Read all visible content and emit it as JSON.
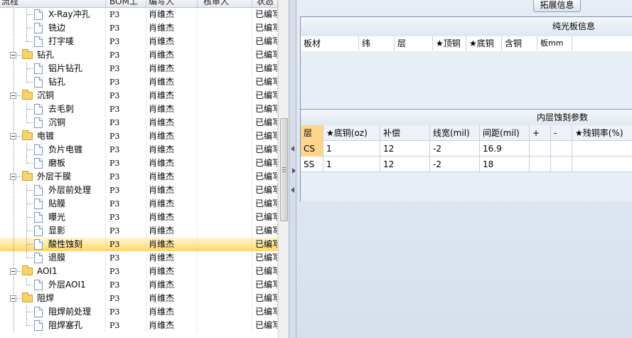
{
  "tree_grid": {
    "columns": {
      "process": "流程",
      "bom": "BOM工",
      "author": "编写人",
      "reviewer": "核审人",
      "status": "状态"
    },
    "rows": [
      {
        "type": "child",
        "label": "X-Ray冲孔",
        "bom": "P3",
        "author": "肖维杰",
        "reviewer": "",
        "status": "已编写",
        "selected": false
      },
      {
        "type": "child",
        "label": "铣边",
        "bom": "P3",
        "author": "肖维杰",
        "reviewer": "",
        "status": "已编写",
        "selected": false
      },
      {
        "type": "child",
        "label": "打字唛",
        "bom": "P3",
        "author": "肖维杰",
        "reviewer": "",
        "status": "已编写",
        "selected": false
      },
      {
        "type": "group",
        "label": "钻孔",
        "bom": "P3",
        "author": "肖维杰",
        "reviewer": "",
        "status": "已编写",
        "selected": false
      },
      {
        "type": "child",
        "label": "铝片钻孔",
        "bom": "P3",
        "author": "肖维杰",
        "reviewer": "",
        "status": "已编写",
        "selected": false
      },
      {
        "type": "child",
        "label": "钻孔",
        "bom": "P3",
        "author": "肖维杰",
        "reviewer": "",
        "status": "已编写",
        "selected": false
      },
      {
        "type": "group",
        "label": "沉铜",
        "bom": "P3",
        "author": "肖维杰",
        "reviewer": "",
        "status": "已编写",
        "selected": false
      },
      {
        "type": "child",
        "label": "去毛刺",
        "bom": "P3",
        "author": "肖维杰",
        "reviewer": "",
        "status": "已编写",
        "selected": false
      },
      {
        "type": "child",
        "label": "沉铜",
        "bom": "P3",
        "author": "肖维杰",
        "reviewer": "",
        "status": "已编写",
        "selected": false
      },
      {
        "type": "group",
        "label": "电镀",
        "bom": "P3",
        "author": "肖维杰",
        "reviewer": "",
        "status": "已编写",
        "selected": false
      },
      {
        "type": "child",
        "label": "负片电镀",
        "bom": "P3",
        "author": "肖维杰",
        "reviewer": "",
        "status": "已编写",
        "selected": false
      },
      {
        "type": "child",
        "label": "磨板",
        "bom": "P3",
        "author": "肖维杰",
        "reviewer": "",
        "status": "已编写",
        "selected": false
      },
      {
        "type": "group",
        "label": "外层干膜",
        "bom": "P3",
        "author": "肖维杰",
        "reviewer": "",
        "status": "已编写",
        "selected": false
      },
      {
        "type": "child",
        "label": "外层前处理",
        "bom": "P3",
        "author": "肖维杰",
        "reviewer": "",
        "status": "已编写",
        "selected": false
      },
      {
        "type": "child",
        "label": "贴膜",
        "bom": "P3",
        "author": "肖维杰",
        "reviewer": "",
        "status": "已编写",
        "selected": false
      },
      {
        "type": "child",
        "label": "曝光",
        "bom": "P3",
        "author": "肖维杰",
        "reviewer": "",
        "status": "已编写",
        "selected": false
      },
      {
        "type": "child",
        "label": "显影",
        "bom": "P3",
        "author": "肖维杰",
        "reviewer": "",
        "status": "已编写",
        "selected": false
      },
      {
        "type": "child",
        "label": "酸性蚀刻",
        "bom": "P3",
        "author": "肖维杰",
        "reviewer": "",
        "status": "已编写",
        "selected": true
      },
      {
        "type": "child",
        "label": "退膜",
        "bom": "P3",
        "author": "肖维杰",
        "reviewer": "",
        "status": "已编写",
        "selected": false
      },
      {
        "type": "group",
        "label": "AOI1",
        "bom": "P3",
        "author": "肖维杰",
        "reviewer": "",
        "status": "已编写",
        "selected": false
      },
      {
        "type": "child",
        "label": "外层AOI1",
        "bom": "P3",
        "author": "肖维杰",
        "reviewer": "",
        "status": "已编写",
        "selected": false
      },
      {
        "type": "group",
        "label": "阻焊",
        "bom": "P3",
        "author": "肖维杰",
        "reviewer": "",
        "status": "已编写",
        "selected": false
      },
      {
        "type": "child",
        "label": "阻焊前处理",
        "bom": "P3",
        "author": "肖维杰",
        "reviewer": "",
        "status": "已编写",
        "selected": false
      },
      {
        "type": "child",
        "label": "阻焊塞孔",
        "bom": "P3",
        "author": "肖维杰",
        "reviewer": "",
        "status": "已编写",
        "selected": false
      }
    ]
  },
  "right_panel": {
    "tab_label": "拓展信息",
    "plain_board": {
      "title": "纯光板信息",
      "headers": [
        "板材",
        "纬",
        "层",
        "★顶铜",
        "★底铜",
        "含铜",
        "板mm"
      ]
    },
    "inner_etch": {
      "title": "内层蚀刻参数",
      "headers": [
        "层",
        "★底铜(oz)",
        "补偿",
        "线宽(mil)",
        "间距(mil)",
        "+",
        "-",
        "★残铜率(%)"
      ],
      "rows": [
        [
          "CS",
          "1",
          "12",
          "-2",
          "16.9",
          "",
          "",
          ""
        ],
        [
          "SS",
          "1",
          "12",
          "-2",
          "18",
          "",
          "",
          ""
        ]
      ]
    }
  },
  "colors": {
    "selection": "#ffd76b",
    "panel_bg": "#d6e0ec",
    "active_cell": "#ffd58c"
  }
}
